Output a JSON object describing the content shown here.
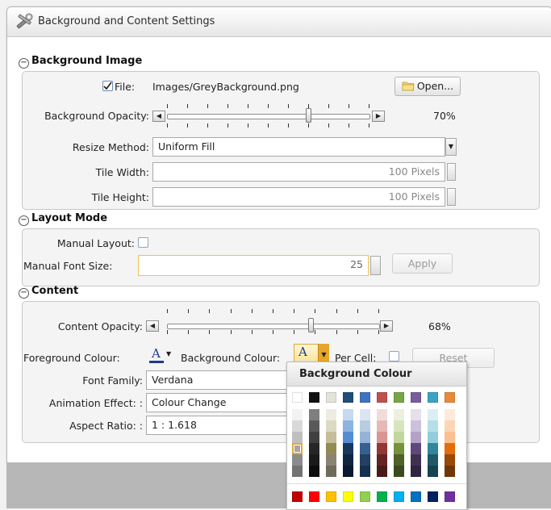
{
  "window": {
    "title": "Background and Content Settings"
  },
  "background_image": {
    "header": "Background Image",
    "file_label": "File:",
    "file_checked": true,
    "file_path": "Images/GreyBackground.png",
    "open_button": "Open...",
    "opacity_label": "Background Opacity:",
    "opacity_value": "70%",
    "opacity_level": 0.7,
    "resize_label": "Resize Method:",
    "resize_value": "Uniform Fill",
    "tile_width_label": "Tile Width:",
    "tile_width_value": "100 Pixels",
    "tile_height_label": "Tile Height:",
    "tile_height_value": "100 Pixels"
  },
  "layout_mode": {
    "header": "Layout Mode",
    "manual_layout_label": "Manual Layout:",
    "manual_layout_checked": false,
    "font_size_label": "Manual Font Size:",
    "font_size_value": "25",
    "apply_button": "Apply"
  },
  "content": {
    "header": "Content",
    "opacity_label": "Content Opacity:",
    "opacity_value": "68%",
    "opacity_level": 0.68,
    "foreground_label": "Foreground Colour:",
    "foreground_glyph": "A",
    "background_label": "Background Colour:",
    "background_glyph": "A",
    "per_cell_label": "Per Cell:",
    "reset_button": "Reset",
    "font_family_label": "Font Family:",
    "font_family_value": "Verdana",
    "animation_label": "Animation Effect: :",
    "animation_value": "Colour Change",
    "aspect_label": "Aspect Ratio: :",
    "aspect_value": "1 : 1.618"
  },
  "colour_popup": {
    "title": "Background Colour",
    "top_row": [
      "#ffffff",
      "#111111",
      "#e4e3d9",
      "#1f4e79",
      "#3f73c0",
      "#c0504d",
      "#77a645",
      "#7a5c9e",
      "#3aa3c2",
      "#e8893a"
    ],
    "columns": [
      [
        "#f2f2f2",
        "#d9d9d9",
        "#bfbfbf",
        "#a6a6a6",
        "#8c8c8c",
        "#737373"
      ],
      [
        "#7f7f7f",
        "#595959",
        "#404040",
        "#262626",
        "#1a1a1a",
        "#0d0d0d"
      ],
      [
        "#eeece1",
        "#ddd9c3",
        "#c4bd97",
        "#948a54",
        "#8a8470",
        "#706c5c"
      ],
      [
        "#c6d9f1",
        "#8db3e2",
        "#548dd4",
        "#17375e",
        "#10253f",
        "#0a1a30"
      ],
      [
        "#dbe5f1",
        "#b8cce4",
        "#95b3d7",
        "#366092",
        "#244062",
        "#16304f"
      ],
      [
        "#f2dcdb",
        "#e6b9b8",
        "#d99694",
        "#953735",
        "#632523",
        "#4a1a19"
      ],
      [
        "#ebf1de",
        "#d7e4bd",
        "#c3d69b",
        "#76923c",
        "#4f6228",
        "#3b4a1e"
      ],
      [
        "#e5e0ec",
        "#ccc1da",
        "#b3a2c7",
        "#5f497a",
        "#403152",
        "#30253e"
      ],
      [
        "#dbeef4",
        "#b7dde8",
        "#92cddc",
        "#31859c",
        "#205867",
        "#17434f"
      ],
      [
        "#fdeada",
        "#fbd5b5",
        "#fac08f",
        "#e46c0a",
        "#984807",
        "#713605"
      ]
    ],
    "standard_row": [
      "#c00000",
      "#ff0000",
      "#ffc000",
      "#ffff00",
      "#92d050",
      "#00b050",
      "#00b0f0",
      "#0070c0",
      "#002060",
      "#7030a0"
    ]
  },
  "icons": {
    "window_icon": "settings-wrench-icon",
    "folder_icon": "folder-icon",
    "foreground_colour_icon": "font-colour-icon",
    "background_colour_icon": "highlight-colour-icon"
  }
}
